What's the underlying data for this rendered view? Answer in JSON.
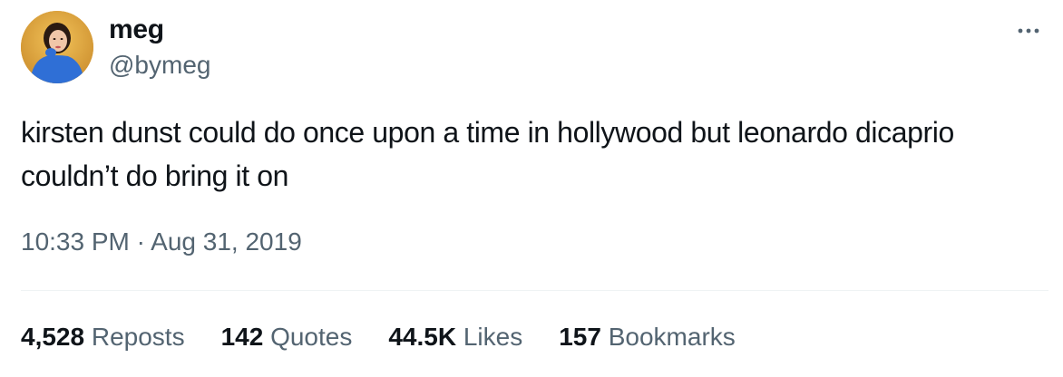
{
  "author": {
    "display_name": "meg",
    "handle": "@bymeg",
    "avatar_icon": "profile-photo"
  },
  "tweet": {
    "text": "kirsten dunst could do once upon a time in hollywood but leonardo dicaprio couldn’t do bring it on",
    "timestamp": "10:33 PM · Aug 31, 2019"
  },
  "more_icon": "ellipsis-icon",
  "stats": [
    {
      "count": "4,528",
      "label": "Reposts"
    },
    {
      "count": "142",
      "label": "Quotes"
    },
    {
      "count": "44.5K",
      "label": "Likes"
    },
    {
      "count": "157",
      "label": "Bookmarks"
    }
  ],
  "colors": {
    "text_primary": "#0f1419",
    "text_secondary": "#536471",
    "divider": "#eff3f4",
    "avatar_bg": "#e2a33a",
    "avatar_sweater": "#2f6fd6"
  }
}
